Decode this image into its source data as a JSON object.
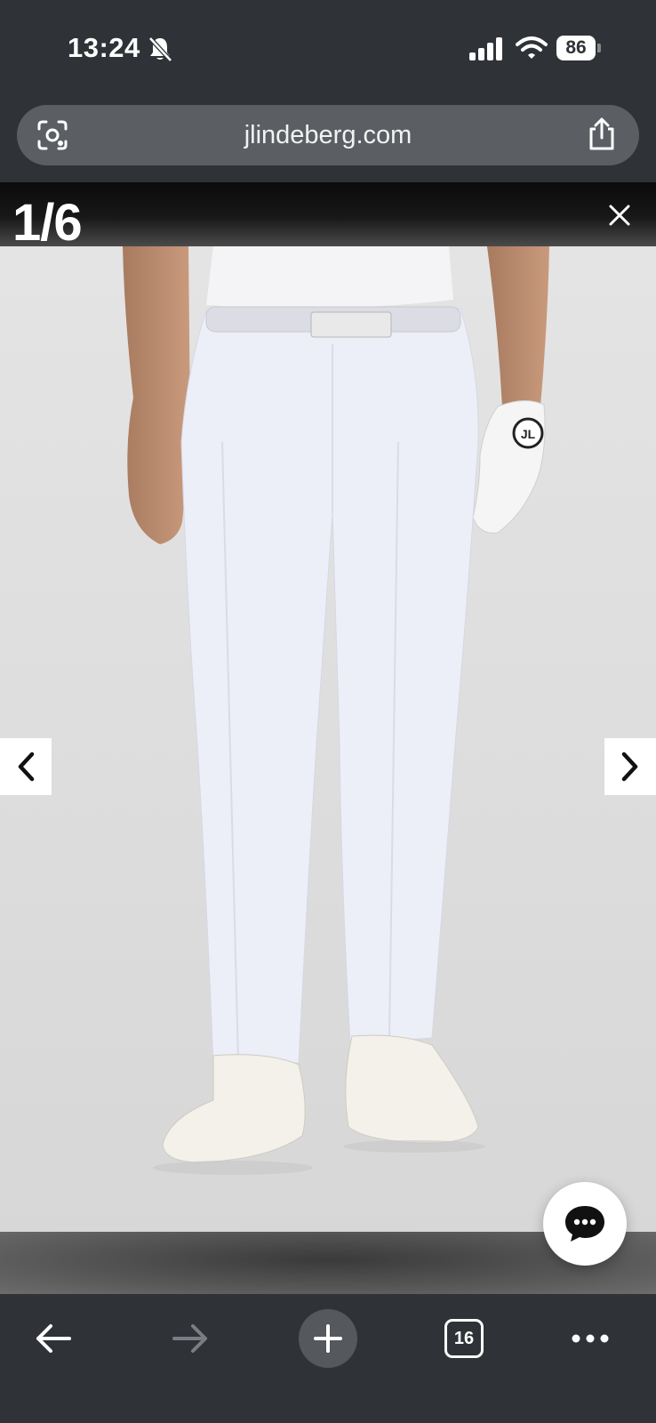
{
  "status_bar": {
    "time": "13:24",
    "battery": "86",
    "icons": [
      "bell-slash-icon",
      "cellular-signal-icon",
      "wifi-icon",
      "battery-icon"
    ]
  },
  "browser": {
    "url": "jlindeberg.com",
    "icons": [
      "visual-search-icon",
      "share-icon"
    ]
  },
  "gallery": {
    "counter": "1/6",
    "icons": [
      "close-icon",
      "chevron-left-icon",
      "chevron-right-icon",
      "chat-bubble-icon"
    ]
  },
  "toolbar": {
    "tab_count": "16",
    "icons": [
      "back-arrow-icon",
      "forward-arrow-icon",
      "plus-icon",
      "tabs-icon",
      "more-icon"
    ]
  },
  "colors": {
    "chrome": "#2f3236",
    "url_field": "#5b5f64",
    "photo_background": "#dcdcdc"
  }
}
